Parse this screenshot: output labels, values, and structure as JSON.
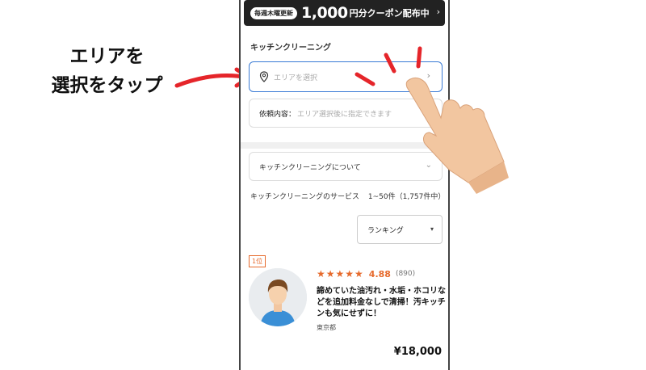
{
  "annotation": {
    "line1": "エリアを",
    "line2": "選択をタップ"
  },
  "banner": {
    "badge": "毎週木曜更新",
    "amount": "1,000",
    "text": "円分クーポン配布中",
    "chevron": "›"
  },
  "service": {
    "title": "キッチンクリーニング"
  },
  "area_select": {
    "icon": "location-pin-icon",
    "placeholder": "エリアを選択",
    "chevron": "›"
  },
  "request": {
    "label": "依頼内容：",
    "value": "エリア選択後に指定できます"
  },
  "about": {
    "label": "キッチンクリーニングについて",
    "chevron": "⌄"
  },
  "listing": {
    "title": "キッチンクリーニングのサービス",
    "count": "1~50件（1,757件中）"
  },
  "sort": {
    "label": "ランキング",
    "caret": "▾"
  },
  "result": {
    "rank": "1位",
    "stars": "★★★★★",
    "rating": "4.88",
    "reviews": "(890)",
    "description": "諦めていた油汚れ・水垢・ホコリなどを追加料金なしで清掃！汚キッチンも気にせずに！",
    "location": "東京都",
    "price": "¥18,000"
  },
  "colors": {
    "accent_blue": "#3a7bd5",
    "annotation_red": "#e5252a",
    "rating_orange": "#e66a2c",
    "banner_dark": "#222222"
  }
}
